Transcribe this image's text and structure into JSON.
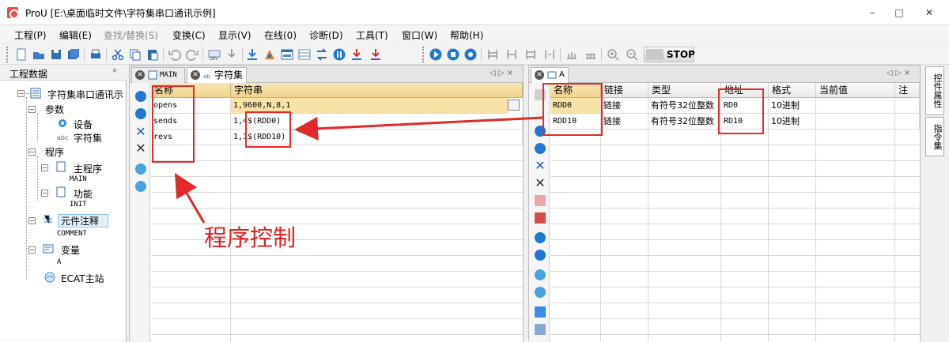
{
  "window": {
    "app": "ProU",
    "path": "[E:\\桌面临时文件\\字符集串口通讯示例]",
    "minimize": "–",
    "maximize": "□",
    "close": "✕"
  },
  "menu": [
    {
      "label": "工程(P)",
      "enabled": true
    },
    {
      "label": "编辑(E)",
      "enabled": true
    },
    {
      "label": "查找/替换(S)",
      "enabled": false
    },
    {
      "label": "变换(C)",
      "enabled": true
    },
    {
      "label": "显示(V)",
      "enabled": true
    },
    {
      "label": "在线(0)",
      "enabled": true
    },
    {
      "label": "诊断(D)",
      "enabled": true
    },
    {
      "label": "工具(T)",
      "enabled": true
    },
    {
      "label": "窗口(W)",
      "enabled": true
    },
    {
      "label": "帮助(H)",
      "enabled": true
    }
  ],
  "toolbar": {
    "stop_label": "STOP"
  },
  "project": {
    "header": "工程数据",
    "pin": "ᵖ",
    "root": "字符集串口通讯示",
    "params": "参数",
    "device": "设备",
    "charset": "字符集",
    "programs": "程序",
    "main_prog": "主程序",
    "main_name": "MAIN",
    "func": "功能",
    "init_name": "INIT",
    "comment_group": "元件注释",
    "comment_name": "COMMENT",
    "vars": "变量",
    "var_a": "A",
    "ecat": "ECAT主站"
  },
  "mid": {
    "tabs": [
      {
        "label": "MAIN"
      },
      {
        "label": "字符集"
      }
    ],
    "nav": "◁ ▷ ×",
    "columns": [
      "名称",
      "字符串"
    ],
    "rows": [
      {
        "name": "opens",
        "value": "1,9600,N,8,1"
      },
      {
        "name": "sends",
        "value": "1,4$(RDD0)"
      },
      {
        "name": "revs",
        "value": "1,1$(RDD10)"
      }
    ]
  },
  "right": {
    "tab": "A",
    "nav": "◁ ▷ ×",
    "columns": [
      "名称",
      "链接",
      "类型",
      "地址",
      "格式",
      "当前值",
      "注"
    ],
    "rows": [
      {
        "name": "RDD0",
        "link": "链接",
        "type": "有符号32位整数",
        "addr": "RD0",
        "format": "10进制",
        "current": ""
      },
      {
        "name": "RDD10",
        "link": "链接",
        "type": "有符号32位整数",
        "addr": "RD10",
        "format": "10进制",
        "current": ""
      }
    ]
  },
  "vtabs": [
    "控件属性",
    "指令集"
  ],
  "annotation": "程序控制",
  "colors": {
    "annotation_red": "#e02020",
    "header_gold": "#f2d38c",
    "selection_blue": "#cfe6fb"
  }
}
